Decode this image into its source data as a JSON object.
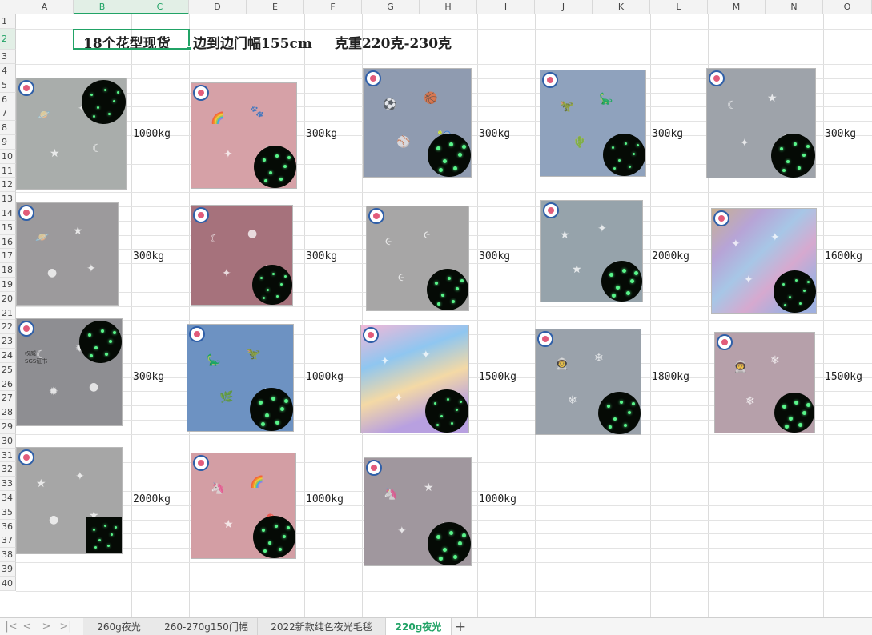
{
  "columns": [
    "A",
    "B",
    "C",
    "D",
    "E",
    "F",
    "G",
    "H",
    "I",
    "J",
    "K",
    "L",
    "M",
    "N",
    "O"
  ],
  "rows": [
    "1",
    "2",
    "3",
    "4",
    "5",
    "6",
    "7",
    "8",
    "9",
    "10",
    "11",
    "12",
    "13",
    "14",
    "15",
    "16",
    "17",
    "18",
    "19",
    "20",
    "21",
    "22",
    "23",
    "24",
    "25",
    "26",
    "27",
    "28",
    "29",
    "30",
    "31",
    "32",
    "33",
    "34",
    "35",
    "36",
    "37",
    "38",
    "39",
    "40"
  ],
  "title": {
    "patterns": "18个花型现货",
    "width": "边到边门幅155cm",
    "weight": "克重220克-230克"
  },
  "products": [
    {
      "theme": "space",
      "quantity": "1000kg",
      "base": "#a9adab",
      "motifs": [
        "🪐",
        "✦",
        "★",
        "☾"
      ],
      "glow": "circle"
    },
    {
      "theme": "pink-rainbow",
      "quantity": "300kg",
      "base": "#d6a1a7",
      "motifs": [
        "🌈",
        "🐾",
        "✦",
        "●"
      ],
      "glow": "circle"
    },
    {
      "theme": "sports",
      "quantity": "300kg",
      "base": "#8f9bb0",
      "motifs": [
        "⚽",
        "🏀",
        "⚾",
        "🎾"
      ],
      "glow": "circle"
    },
    {
      "theme": "dinosaur",
      "quantity": "300kg",
      "base": "#8fa2bd",
      "motifs": [
        "🦖",
        "🦕",
        "🌵",
        "★"
      ],
      "glow": "circle"
    },
    {
      "theme": "moon-star",
      "quantity": "300kg",
      "base": "#9ea3aa",
      "motifs": [
        "☾",
        "★",
        "✦",
        "●"
      ],
      "glow": "circle"
    },
    {
      "theme": "planets",
      "quantity": "300kg",
      "base": "#9c9a9c",
      "motifs": [
        "🪐",
        "★",
        "●",
        "✦"
      ],
      "glow": "none"
    },
    {
      "theme": "pink-moon",
      "quantity": "300kg",
      "base": "#a6727c",
      "motifs": [
        "☾",
        "●",
        "✦",
        "★"
      ],
      "glow": "circle"
    },
    {
      "theme": "swirl",
      "quantity": "300kg",
      "base": "#a7a6a6",
      "motifs": [
        "૯",
        "૯",
        "૯",
        "૯"
      ],
      "glow": "circle"
    },
    {
      "theme": "mermaid",
      "quantity": "2000kg",
      "base": "#96a3ab",
      "motifs": [
        "★",
        "✦",
        "★",
        "✦"
      ],
      "glow": "circle"
    },
    {
      "theme": "rainbow-stripe",
      "quantity": "1600kg",
      "base": "#b4a7cb",
      "motifs": [
        "✦",
        "✦",
        "✦",
        "✦"
      ],
      "glow": "circle"
    },
    {
      "theme": "moon-grey",
      "quantity": "300kg",
      "base": "#8e8e92",
      "motifs": [
        "☾",
        "✹",
        "✹",
        "●"
      ],
      "glow": "circle"
    },
    {
      "theme": "blue-dino",
      "quantity": "1000kg",
      "base": "#6d92c2",
      "motifs": [
        "🦕",
        "🦖",
        "🌿",
        "★"
      ],
      "glow": "circle"
    },
    {
      "theme": "rainbow-tie-dye",
      "quantity": "1500kg",
      "base": "#c9a5c8",
      "motifs": [
        "✦",
        "✦",
        "✦",
        "✦"
      ],
      "glow": "circle"
    },
    {
      "theme": "astronaut",
      "quantity": "1800kg",
      "base": "#9aa2ab",
      "motifs": [
        "👨‍🚀",
        "❄",
        "❄",
        "★"
      ],
      "glow": "circle"
    },
    {
      "theme": "astronaut-pink",
      "quantity": "1500kg",
      "base": "#b6a0aa",
      "motifs": [
        "👨‍🚀",
        "❄",
        "❄",
        "★"
      ],
      "glow": "circle"
    },
    {
      "theme": "grey-stars",
      "quantity": "2000kg",
      "base": "#a6a6a6",
      "motifs": [
        "★",
        "✦",
        "●",
        "★"
      ],
      "glow": "square"
    },
    {
      "theme": "unicorn-pink",
      "quantity": "1000kg",
      "base": "#d39ea4",
      "motifs": [
        "🦄",
        "🌈",
        "★",
        "🎈"
      ],
      "glow": "circle"
    },
    {
      "theme": "unicorn-grey",
      "quantity": "1000kg",
      "base": "#a0979e",
      "motifs": [
        "🦄",
        "★",
        "✦",
        "★"
      ],
      "glow": "circle"
    }
  ],
  "stamp": "权威\nSGS证书",
  "tabs": {
    "items": [
      "260g夜光",
      "260-270g150门幅",
      "2022新款纯色夜光毛毯",
      "220g夜光"
    ],
    "add": "+",
    "nav": [
      "|<",
      "<",
      ">",
      ">|"
    ]
  },
  "colors": {
    "accent": "#21a366",
    "glow": "#59f58a",
    "logo": "#2f5fa8"
  }
}
